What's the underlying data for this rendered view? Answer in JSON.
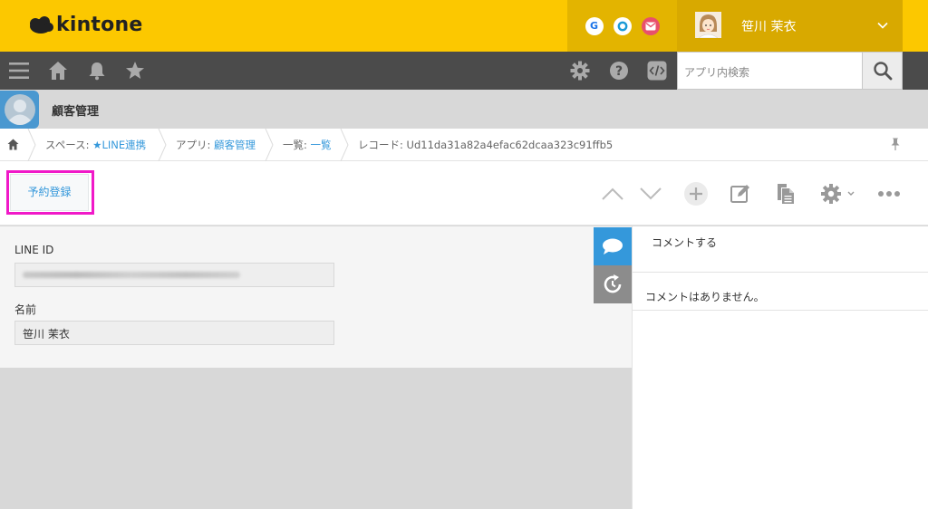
{
  "header": {
    "logo_text": "kintone",
    "services": [
      {
        "icon": "garoon-icon",
        "letter": "G",
        "color": "#1a73e8"
      },
      {
        "icon": "office-icon",
        "letter": "○",
        "color": "#1b9ad6"
      },
      {
        "icon": "mail-icon",
        "letter": "✉",
        "color": "#e8506c"
      }
    ],
    "user_name": "笹川 茉衣"
  },
  "navbar": {
    "search_placeholder": "アプリ内検索"
  },
  "app": {
    "title": "顧客管理"
  },
  "breadcrumb": {
    "space_prefix": "スペース: ",
    "space_name": "★LINE連携",
    "app_prefix": "アプリ: ",
    "app_name": "顧客管理",
    "view_prefix": "一覧: ",
    "view_name": "一覧",
    "record_label": "レコード: Ud11da31a82a4efac62dcaa323c91ffb5"
  },
  "actions": {
    "reserve_button": "予約登録"
  },
  "record": {
    "fields": [
      {
        "label": "LINE ID",
        "value": ""
      },
      {
        "label": "名前",
        "value": "笹川 茉衣"
      }
    ]
  },
  "comments": {
    "placeholder": "コメントする",
    "empty": "コメントはありません。"
  },
  "colors": {
    "brand_yellow": "#fcc800",
    "navbar": "#4b4b4b",
    "link": "#3498db",
    "highlight": "#f019c8"
  }
}
